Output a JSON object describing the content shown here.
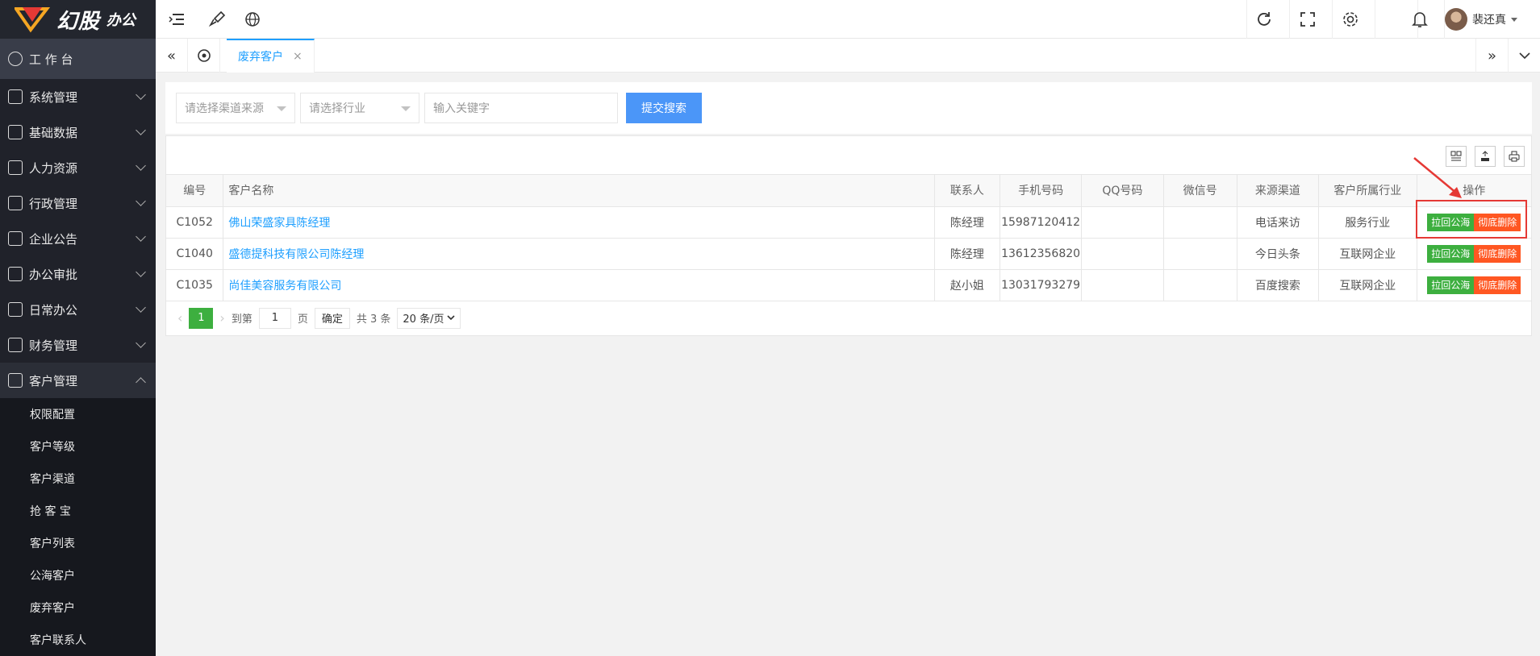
{
  "app": {
    "logo_text": "幻股",
    "logo_sub": "办公",
    "logo_mark": "DA"
  },
  "sidebar": {
    "workbench": "工 作 台",
    "items": [
      {
        "label": "系统管理"
      },
      {
        "label": "基础数据"
      },
      {
        "label": "人力资源"
      },
      {
        "label": "行政管理"
      },
      {
        "label": "企业公告"
      },
      {
        "label": "办公审批"
      },
      {
        "label": "日常办公"
      },
      {
        "label": "财务管理"
      },
      {
        "label": "客户管理"
      }
    ],
    "sub_items": [
      {
        "label": "权限配置"
      },
      {
        "label": "客户等级"
      },
      {
        "label": "客户渠道"
      },
      {
        "label": "抢 客 宝"
      },
      {
        "label": "客户列表"
      },
      {
        "label": "公海客户"
      },
      {
        "label": "废弃客户"
      },
      {
        "label": "客户联系人"
      }
    ]
  },
  "topbar": {
    "user_name": "裴还真"
  },
  "tabs": {
    "active": "废弃客户",
    "close": "×"
  },
  "search": {
    "channel_placeholder": "请选择渠道来源",
    "industry_placeholder": "请选择行业",
    "keyword_placeholder": "输入关键字",
    "submit": "提交搜索"
  },
  "table": {
    "headers": [
      "编号",
      "客户名称",
      "联系人",
      "手机号码",
      "QQ号码",
      "微信号",
      "来源渠道",
      "客户所属行业",
      "操作"
    ],
    "rows": [
      {
        "id": "C1052",
        "name": "佛山荣盛家具陈经理",
        "contact": "陈经理",
        "phone": "15987120412",
        "qq": "",
        "wechat": "",
        "source": "电话来访",
        "industry": "服务行业"
      },
      {
        "id": "C1040",
        "name": "盛德提科技有限公司陈经理",
        "contact": "陈经理",
        "phone": "13612356820",
        "qq": "",
        "wechat": "",
        "source": "今日头条",
        "industry": "互联网企业"
      },
      {
        "id": "C1035",
        "name": "尚佳美容服务有限公司",
        "contact": "赵小姐",
        "phone": "13031793279",
        "qq": "",
        "wechat": "",
        "source": "百度搜索",
        "industry": "互联网企业"
      }
    ],
    "action_restore": "拉回公海",
    "action_delete": "彻底删除"
  },
  "pager": {
    "current": "1",
    "goto_prefix": "到第",
    "goto_value": "1",
    "goto_suffix": "页",
    "confirm": "确定",
    "total": "共 3 条",
    "per_page": "20 条/页"
  },
  "colors": {
    "sidebar_bg": "#20222a",
    "accent": "#1e9fff",
    "green": "#3daf3f",
    "orange": "#ff5722",
    "highlight": "#e53935"
  }
}
